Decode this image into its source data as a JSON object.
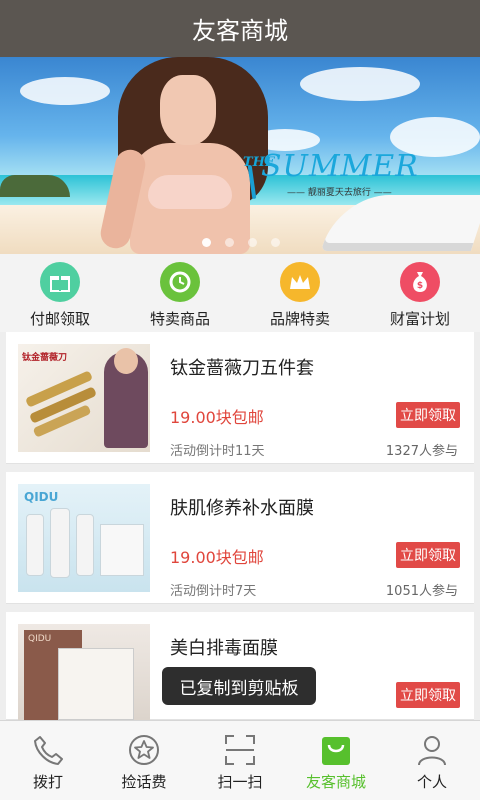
{
  "header": {
    "title": "友客商城"
  },
  "banner": {
    "the_text": "THE",
    "summer_text": "SUMMER",
    "subtitle": "—— 靓丽夏天去旅行 ——"
  },
  "categories": [
    {
      "label": "付邮领取",
      "icon": "gift-icon",
      "color": "#4fcfa0"
    },
    {
      "label": "特卖商品",
      "icon": "sale-clock-icon",
      "color": "#6ac23c"
    },
    {
      "label": "品牌特卖",
      "icon": "crown-icon",
      "color": "#f6b72c"
    },
    {
      "label": "财富计划",
      "icon": "money-bag-icon",
      "color": "#ef4d64"
    }
  ],
  "products": [
    {
      "name": "钛金蔷薇刀五件套",
      "price": "19.00块包邮",
      "button": "立即领取",
      "countdown": "活动倒计时11天",
      "participants": "1327人参与",
      "thumb_text": "钛金蔷薇刀"
    },
    {
      "name": "肤肌修养补水面膜",
      "price": "19.00块包邮",
      "button": "立即领取",
      "countdown": "活动倒计时7天",
      "participants": "1051人参与",
      "thumb_text": "QIDU"
    },
    {
      "name": "美白排毒面膜",
      "price": "",
      "button": "立即领取",
      "countdown": "",
      "participants": "",
      "thumb_text": "QIDU"
    }
  ],
  "toast": {
    "text": "已复制到剪贴板"
  },
  "tabbar": [
    {
      "label": "拨打",
      "icon": "phone-icon"
    },
    {
      "label": "捡话费",
      "icon": "star-coin-icon"
    },
    {
      "label": "扫一扫",
      "icon": "scan-icon"
    },
    {
      "label": "友客商城",
      "icon": "shopping-bag-icon",
      "active": true
    },
    {
      "label": "个人",
      "icon": "user-icon"
    }
  ],
  "colors": {
    "accent": "#57c02d",
    "price": "#e0463c",
    "button": "#e14a47",
    "header": "#5b5651"
  }
}
